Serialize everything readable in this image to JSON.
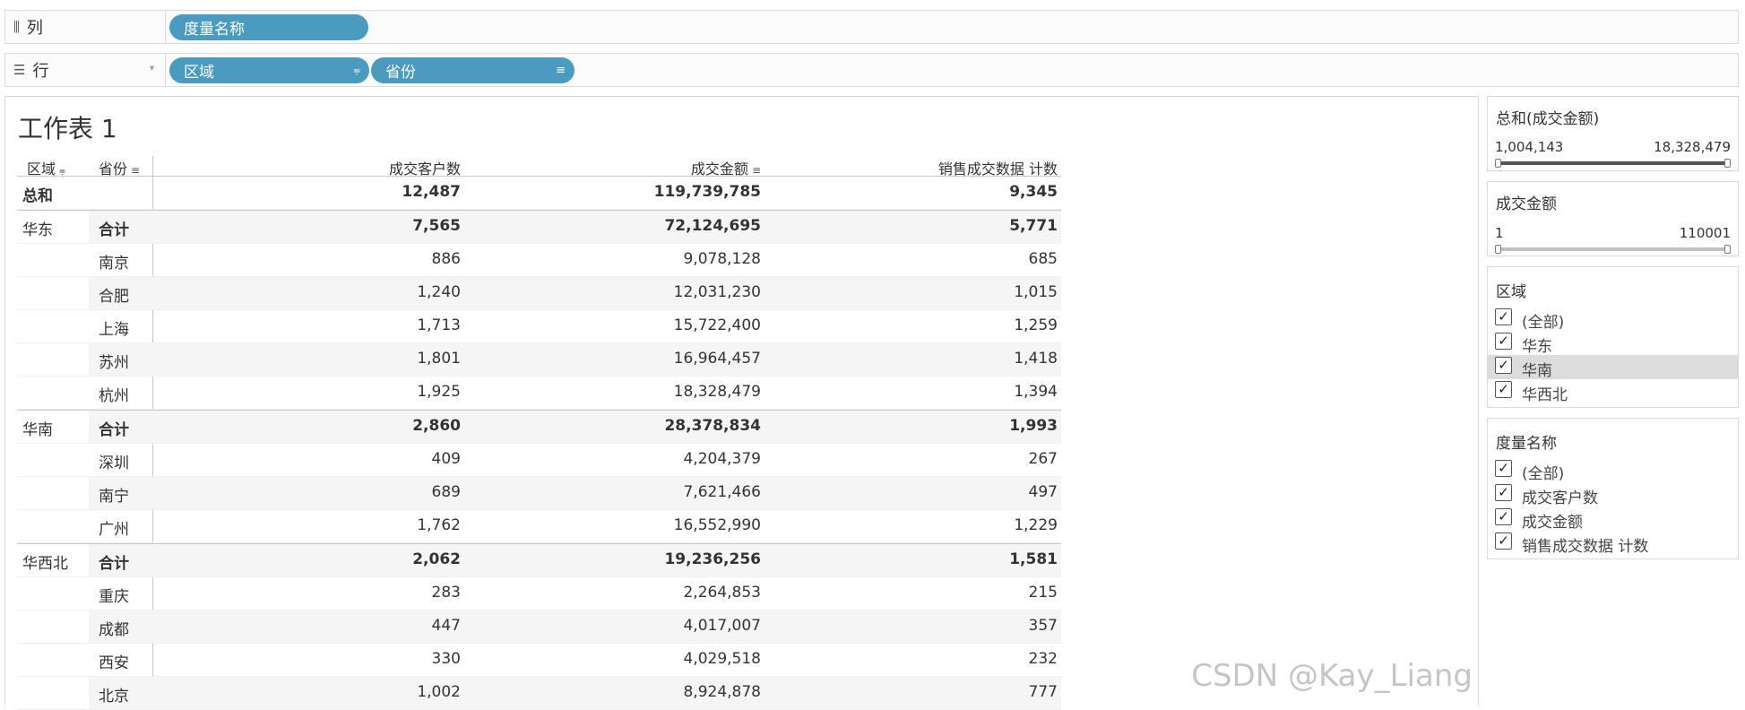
{
  "shelves": {
    "columns": {
      "label": "列",
      "pills": [
        {
          "label": "度量名称"
        }
      ]
    },
    "rows": {
      "label": "行",
      "pills": [
        {
          "label": "区域"
        },
        {
          "label": "省份"
        }
      ]
    }
  },
  "worksheet": {
    "title": "工作表 1",
    "headers": {
      "region": "区域",
      "province": "省份",
      "customers": "成交客户数",
      "amount": "成交金额",
      "count": "销售成交数据 计数"
    },
    "grand_total": {
      "label": "总和",
      "customers": "12,487",
      "amount": "119,739,785",
      "count": "9,345"
    },
    "groups": [
      {
        "region": "华东",
        "rows": [
          {
            "province": "合计",
            "customers": "7,565",
            "amount": "72,124,695",
            "count": "5,771",
            "total": true
          },
          {
            "province": "南京",
            "customers": "886",
            "amount": "9,078,128",
            "count": "685"
          },
          {
            "province": "合肥",
            "customers": "1,240",
            "amount": "12,031,230",
            "count": "1,015"
          },
          {
            "province": "上海",
            "customers": "1,713",
            "amount": "15,722,400",
            "count": "1,259"
          },
          {
            "province": "苏州",
            "customers": "1,801",
            "amount": "16,964,457",
            "count": "1,418"
          },
          {
            "province": "杭州",
            "customers": "1,925",
            "amount": "18,328,479",
            "count": "1,394"
          }
        ]
      },
      {
        "region": "华南",
        "rows": [
          {
            "province": "合计",
            "customers": "2,860",
            "amount": "28,378,834",
            "count": "1,993",
            "total": true
          },
          {
            "province": "深圳",
            "customers": "409",
            "amount": "4,204,379",
            "count": "267"
          },
          {
            "province": "南宁",
            "customers": "689",
            "amount": "7,621,466",
            "count": "497"
          },
          {
            "province": "广州",
            "customers": "1,762",
            "amount": "16,552,990",
            "count": "1,229"
          }
        ]
      },
      {
        "region": "华西北",
        "rows": [
          {
            "province": "合计",
            "customers": "2,062",
            "amount": "19,236,256",
            "count": "1,581",
            "total": true
          },
          {
            "province": "重庆",
            "customers": "283",
            "amount": "2,264,853",
            "count": "215"
          },
          {
            "province": "成都",
            "customers": "447",
            "amount": "4,017,007",
            "count": "357"
          },
          {
            "province": "西安",
            "customers": "330",
            "amount": "4,029,518",
            "count": "232"
          },
          {
            "province": "北京",
            "customers": "1,002",
            "amount": "8,924,878",
            "count": "777"
          }
        ]
      }
    ]
  },
  "filters": {
    "sum_amount": {
      "title": "总和(成交金额)",
      "min": "1,004,143",
      "max": "18,328,479"
    },
    "amount": {
      "title": "成交金额",
      "min": "1",
      "max": "110001"
    },
    "region": {
      "title": "区域",
      "items": [
        {
          "label": "(全部)",
          "checked": true
        },
        {
          "label": "华东",
          "checked": true
        },
        {
          "label": "华南",
          "checked": true,
          "highlighted": true
        },
        {
          "label": "华西北",
          "checked": true
        }
      ]
    },
    "measure": {
      "title": "度量名称",
      "items": [
        {
          "label": "(全部)",
          "checked": true
        },
        {
          "label": "成交客户数",
          "checked": true
        },
        {
          "label": "成交金额",
          "checked": true
        },
        {
          "label": "销售成交数据 计数",
          "checked": true
        }
      ]
    }
  },
  "watermark": "CSDN @Kay_Liang",
  "colors": {
    "pill": "#4a9bbf",
    "highlight": "#dcdcdc"
  }
}
